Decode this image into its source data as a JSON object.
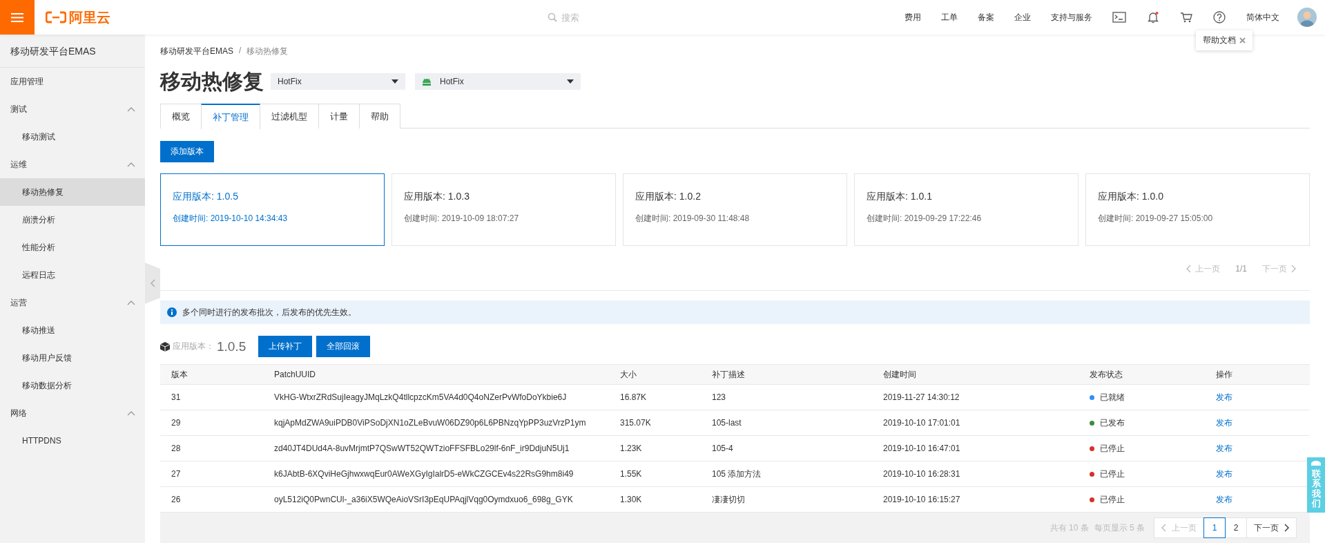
{
  "topbar": {
    "logo": "阿里云",
    "search": {
      "placeholder": "搜索"
    },
    "links": [
      "费用",
      "工单",
      "备案",
      "企业",
      "支持与服务"
    ],
    "language": "简体中文"
  },
  "tooltip": {
    "text": "帮助文档"
  },
  "sidebar": {
    "title": "移动研发平台EMAS",
    "items": [
      {
        "kind": "item",
        "label": "应用管理",
        "selected": false
      },
      {
        "kind": "group",
        "label": "测试",
        "expanded": true,
        "children": [
          {
            "label": "移动测试",
            "selected": false
          }
        ]
      },
      {
        "kind": "group",
        "label": "运维",
        "expanded": true,
        "children": [
          {
            "label": "移动热修复",
            "selected": true
          },
          {
            "label": "崩溃分析",
            "selected": false
          },
          {
            "label": "性能分析",
            "selected": false
          },
          {
            "label": "远程日志",
            "selected": false
          }
        ]
      },
      {
        "kind": "group",
        "label": "运营",
        "expanded": true,
        "children": [
          {
            "label": "移动推送",
            "selected": false
          },
          {
            "label": "移动用户反馈",
            "selected": false
          },
          {
            "label": "移动数据分析",
            "selected": false
          }
        ]
      },
      {
        "kind": "group",
        "label": "网络",
        "expanded": true,
        "children": [
          {
            "label": "HTTPDNS",
            "selected": false
          }
        ]
      }
    ]
  },
  "breadcrumb": {
    "items": [
      "移动研发平台EMAS",
      "移动热修复"
    ],
    "separator": "/"
  },
  "page_title": "移动热修复",
  "selects": [
    {
      "kind": "app",
      "value": "HotFix"
    },
    {
      "kind": "platform",
      "value": "HotFix"
    }
  ],
  "tabs": [
    {
      "label": "概览",
      "selected": false
    },
    {
      "label": "补丁管理",
      "selected": true
    },
    {
      "label": "过滤机型",
      "selected": false
    },
    {
      "label": "计量",
      "selected": false
    },
    {
      "label": "帮助",
      "selected": false
    }
  ],
  "add_button": "添加版本",
  "versions": [
    {
      "title": "应用版本: 1.0.5",
      "created": "创建时间: 2019-10-10 14:34:43",
      "selected": true
    },
    {
      "title": "应用版本: 1.0.3",
      "created": "创建时间: 2019-10-09 18:07:27",
      "selected": false
    },
    {
      "title": "应用版本: 1.0.2",
      "created": "创建时间: 2019-09-30 11:48:48",
      "selected": false
    },
    {
      "title": "应用版本: 1.0.1",
      "created": "创建时间: 2019-09-29 17:22:46",
      "selected": false
    },
    {
      "title": "应用版本: 1.0.0",
      "created": "创建时间: 2019-09-27 15:05:00",
      "selected": false
    }
  ],
  "version_pager": {
    "prev": {
      "label": "上一页",
      "disabled": true
    },
    "page": "1/1",
    "next": {
      "label": "下一页",
      "disabled": true
    }
  },
  "notice": "多个同时进行的发布批次，后发布的优先生效。",
  "current_version": {
    "label": "应用版本：",
    "value": "1.0.5"
  },
  "actions": [
    "上传补丁",
    "全部回滚"
  ],
  "table": {
    "columns": [
      "版本",
      "PatchUUID",
      "大小",
      "补丁描述",
      "创建时间",
      "发布状态",
      "操作"
    ],
    "rows": [
      {
        "version": "31",
        "uuid": "VkHG-WtxrZRdSujIeagyJMqLzkQ4tllcpzcKm5VA4d0Q4oNZerPvWfoDoYkbie6J",
        "size": "16.87K",
        "description": "123",
        "created": "2019-11-27 14:30:12",
        "status": {
          "label": "已就绪",
          "color": "#2f8ff5"
        },
        "action": "发布"
      },
      {
        "version": "29",
        "uuid": "kqjApMdZWA9uiPDB0ViPSoDjXN1oZLeBvuW06DZ90p6L6PBNzqYpPP3uzVrzP1ym",
        "size": "315.07K",
        "description": "105-last",
        "created": "2019-10-10 17:01:01",
        "status": {
          "label": "已发布",
          "color": "#3b8c3d"
        },
        "action": "发布"
      },
      {
        "version": "28",
        "uuid": "zd40JT4DUd4A-8uvMrjmtP7QSwWT52QWTzioFFSFBLo29lf-6nF_ir9DdjuN5Uj1",
        "size": "1.23K",
        "description": "105-4",
        "created": "2019-10-10 16:47:01",
        "status": {
          "label": "已停止",
          "color": "#d9302b"
        },
        "action": "发布"
      },
      {
        "version": "27",
        "uuid": "k6JAbtB-6XQviHeGjhwxwqEur0AWeXGyIgIalrD5-eWkCZGCEv4s22RsG9hm8i49",
        "size": "1.55K",
        "description": "105 添加方法",
        "created": "2019-10-10 16:28:31",
        "status": {
          "label": "已停止",
          "color": "#d9302b"
        },
        "action": "发布"
      },
      {
        "version": "26",
        "uuid": "oyL512iQ0PwnCUl-_a36iX5WQeAioVSrI3pEqUPAqjlVqg0Oymdxuo6_698g_GYK",
        "size": "1.30K",
        "description": "凄凄切切",
        "created": "2019-10-10 16:15:27",
        "status": {
          "label": "已停止",
          "color": "#d9302b"
        },
        "action": "发布"
      }
    ]
  },
  "pager": {
    "total": "共有 10 条",
    "per_page": "每页显示 5 条",
    "prev": {
      "label": "上一页",
      "disabled": true
    },
    "pages": [
      {
        "label": "1",
        "selected": true
      },
      {
        "label": "2",
        "selected": false
      }
    ],
    "next": {
      "label": "下一页",
      "disabled": false
    }
  },
  "contact": "联系我们"
}
